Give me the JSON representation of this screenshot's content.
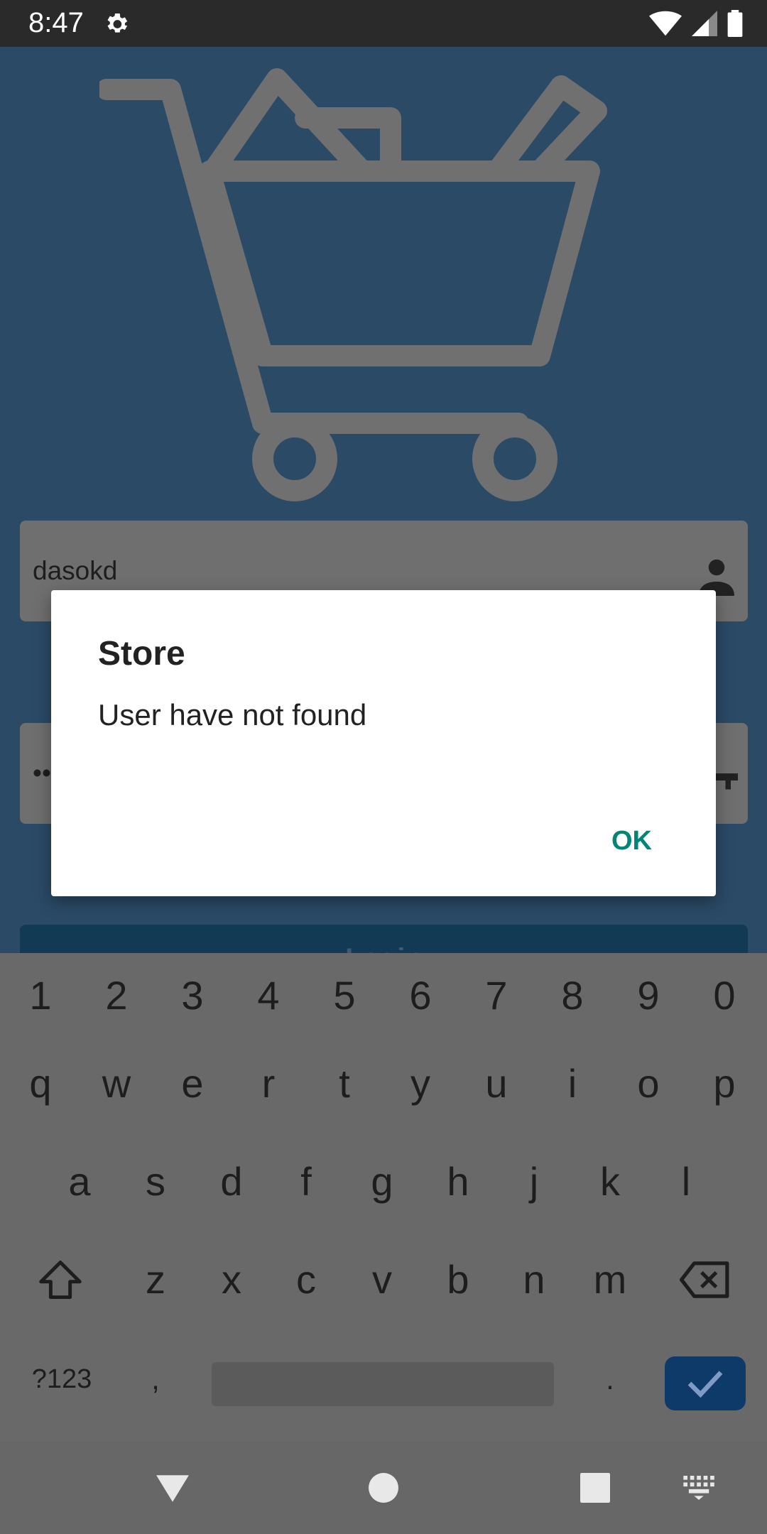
{
  "status_bar": {
    "time": "8:47",
    "icons": [
      "gear-icon",
      "wifi-icon",
      "cellular-signal-icon",
      "battery-icon"
    ]
  },
  "login_form": {
    "username_value": "dasokd",
    "password_value": "••",
    "login_button_label": "Login",
    "icons": [
      "shopping-cart-icon",
      "person-icon",
      "key-icon"
    ]
  },
  "dialog": {
    "title": "Store",
    "message": "User have not found",
    "ok_label": "OK"
  },
  "keyboard": {
    "number_row": [
      "1",
      "2",
      "3",
      "4",
      "5",
      "6",
      "7",
      "8",
      "9",
      "0"
    ],
    "row1": [
      "q",
      "w",
      "e",
      "r",
      "t",
      "y",
      "u",
      "i",
      "o",
      "p"
    ],
    "row2": [
      "a",
      "s",
      "d",
      "f",
      "g",
      "h",
      "j",
      "k",
      "l"
    ],
    "row3": [
      "z",
      "x",
      "c",
      "v",
      "b",
      "n",
      "m"
    ],
    "symbols_label": "?123",
    "comma": ",",
    "period": ".",
    "icons": [
      "shift-icon",
      "backspace-icon",
      "checkmark-icon"
    ]
  },
  "nav_bar": {
    "icons": [
      "back-icon",
      "home-icon",
      "recents-icon",
      "keyboard-switch-icon"
    ]
  },
  "colors": {
    "app_background": "#2b4a66",
    "dialog_button": "#008577",
    "enter_key": "#0d3a69",
    "scrim": "#696969"
  }
}
